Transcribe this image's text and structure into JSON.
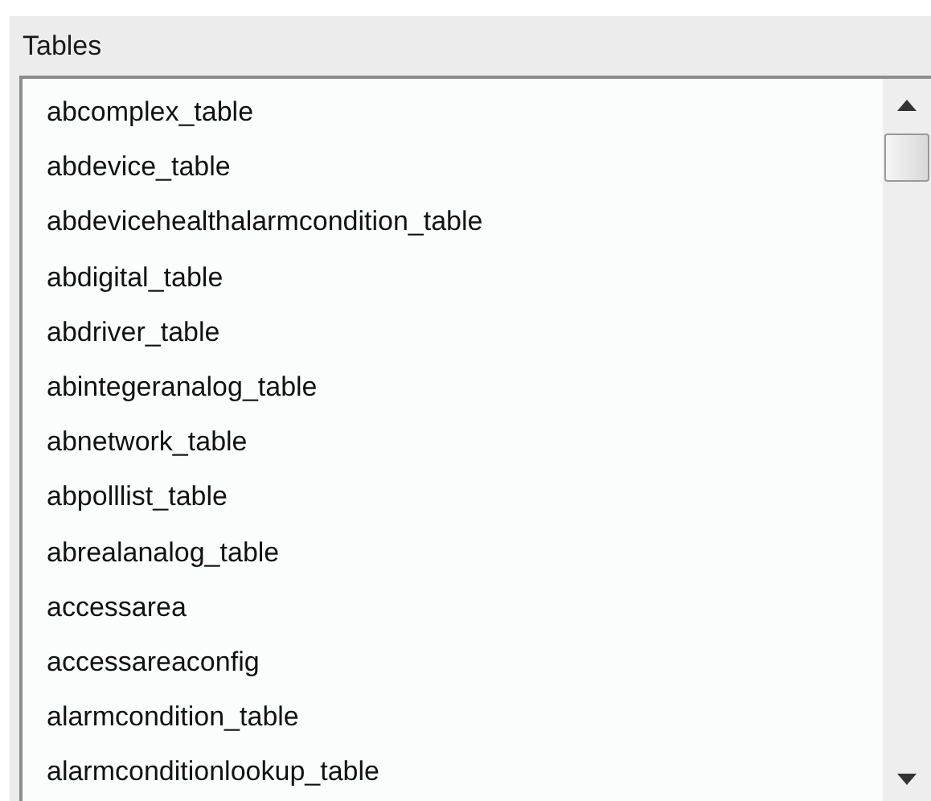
{
  "group": {
    "label": "Tables"
  },
  "list": {
    "items": [
      {
        "label": "abcomplex_table",
        "selected": false
      },
      {
        "label": "abdevice_table",
        "selected": false
      },
      {
        "label": "abdevicehealthalarmcondition_table",
        "selected": false
      },
      {
        "label": "abdigital_table",
        "selected": false
      },
      {
        "label": "abdriver_table",
        "selected": false
      },
      {
        "label": "abintegeranalog_table",
        "selected": false
      },
      {
        "label": "abnetwork_table",
        "selected": false
      },
      {
        "label": "abpolllist_table",
        "selected": false
      },
      {
        "label": "abrealanalog_table",
        "selected": false
      },
      {
        "label": "accessarea",
        "selected": false
      },
      {
        "label": "accessareaconfig",
        "selected": false
      },
      {
        "label": "alarmcondition_table",
        "selected": false
      },
      {
        "label": "alarmconditionlookup_table",
        "selected": false
      }
    ]
  }
}
